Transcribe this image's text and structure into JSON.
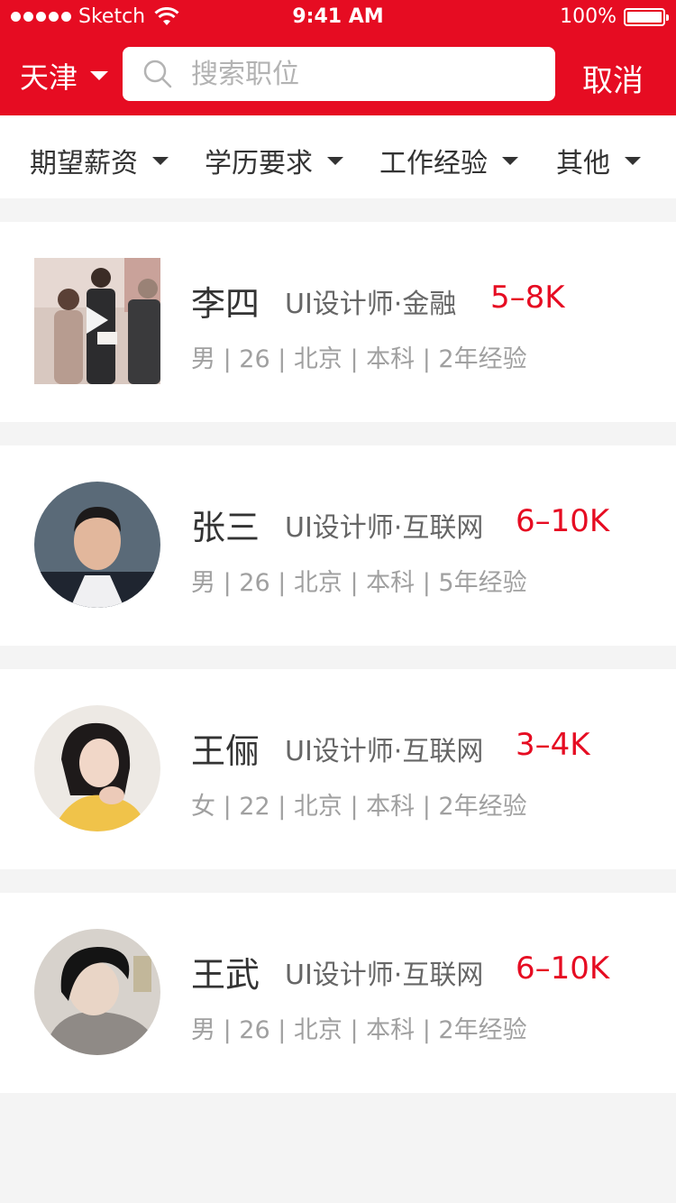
{
  "status_bar": {
    "carrier": "Sketch",
    "time": "9:41 AM",
    "battery": "100%"
  },
  "header": {
    "city": "天津",
    "search_placeholder": "搜索职位",
    "cancel_label": "取消"
  },
  "filters": [
    {
      "label": "期望薪资"
    },
    {
      "label": "学历要求"
    },
    {
      "label": "工作经验"
    },
    {
      "label": "其他"
    }
  ],
  "candidates": [
    {
      "name": "李四",
      "role": "UI设计师·金融",
      "salary": "5–8K",
      "meta": "男 | 26 | 北京 | 本科 | 2年经验",
      "has_video": true
    },
    {
      "name": "张三",
      "role": "UI设计师·互联网",
      "salary": "6–10K",
      "meta": "男 | 26 | 北京 | 本科 | 5年经验",
      "has_video": false
    },
    {
      "name": "王俪",
      "role": "UI设计师·互联网",
      "salary": "3–4K",
      "meta": "女 | 22 | 北京 | 本科 | 2年经验",
      "has_video": false
    },
    {
      "name": "王武",
      "role": "UI设计师·互联网",
      "salary": "6–10K",
      "meta": "男 | 26 | 北京 | 本科 | 2年经验",
      "has_video": false
    }
  ],
  "colors": {
    "brand_red": "#e60c22",
    "background": "#f4f4f4"
  }
}
